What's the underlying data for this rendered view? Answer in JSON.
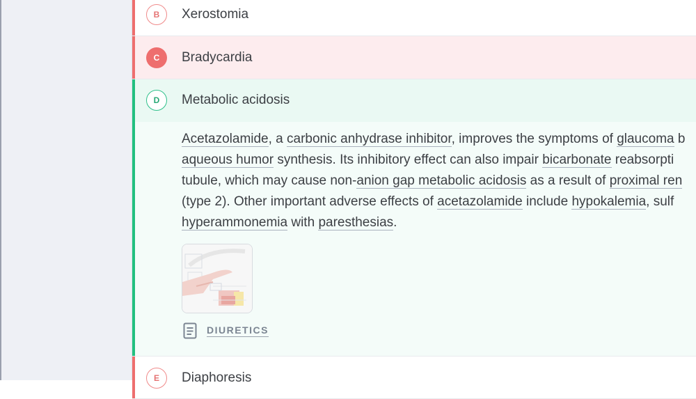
{
  "options": [
    {
      "letter": "B",
      "label": "Xerostomia",
      "state": "incorrect-outline"
    },
    {
      "letter": "C",
      "label": "Bradycardia",
      "state": "selected-incorrect"
    },
    {
      "letter": "D",
      "label": "Metabolic acidosis",
      "state": "correct"
    },
    {
      "letter": "E",
      "label": "Diaphoresis",
      "state": "incorrect-outline"
    }
  ],
  "explanation": {
    "lines": [
      [
        {
          "text": "Acetazolamide",
          "link": true
        },
        {
          "text": ", a ",
          "link": false
        },
        {
          "text": "carbonic anhydrase inhibitor",
          "link": true
        },
        {
          "text": ", improves the symptoms of ",
          "link": false
        },
        {
          "text": "glaucoma",
          "link": true
        },
        {
          "text": " b",
          "link": false
        }
      ],
      [
        {
          "text": "aqueous humor",
          "link": true
        },
        {
          "text": " synthesis. Its inhibitory effect can also impair ",
          "link": false
        },
        {
          "text": "bicarbonate",
          "link": true
        },
        {
          "text": " reabsorpti",
          "link": false
        }
      ],
      [
        {
          "text": "tubule, which may cause non-",
          "link": false
        },
        {
          "text": "anion gap metabolic acidosis",
          "link": true
        },
        {
          "text": " as a result of ",
          "link": false
        },
        {
          "text": "proximal ren",
          "link": true
        }
      ],
      [
        {
          "text": "(type 2). Other important adverse effects of ",
          "link": false
        },
        {
          "text": "acetazolamide",
          "link": true
        },
        {
          "text": " include ",
          "link": false
        },
        {
          "text": "hypokalemia",
          "link": true
        },
        {
          "text": ", sulf",
          "link": false
        }
      ],
      [
        {
          "text": "hyperammonemia",
          "link": true
        },
        {
          "text": " with ",
          "link": false
        },
        {
          "text": "paresthesias",
          "link": true
        },
        {
          "text": ".",
          "link": false
        }
      ]
    ],
    "topic_link": "DIURETICS",
    "topic_icon": "document-icon"
  },
  "colors": {
    "incorrect": "#ee6e6e",
    "correct": "#22bf80",
    "selected_incorrect_bg": "#fdecee",
    "correct_bg": "#eaf9f3"
  }
}
